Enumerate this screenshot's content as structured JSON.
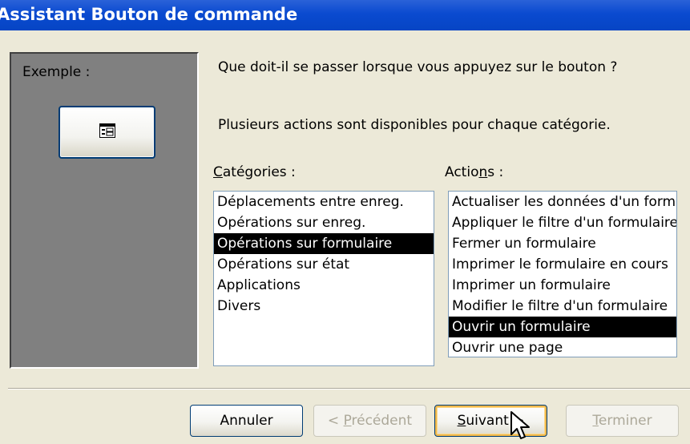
{
  "window": {
    "title": "Assistant Bouton de commande"
  },
  "example": {
    "label": "Exemple :",
    "button_icon": "form-icon"
  },
  "instructions": {
    "question": "Que doit-il se passer lorsque vous appuyez sur le bouton ?",
    "info": "Plusieurs actions sont disponibles pour chaque catégorie."
  },
  "categories": {
    "label_pre": "",
    "label_access": "C",
    "label_post": "atégories :",
    "selected": "Opérations sur formulaire",
    "items": [
      "Déplacements entre enreg.",
      "Opérations sur enreg.",
      "Opérations sur formulaire",
      "Opérations sur état",
      "Applications",
      "Divers"
    ]
  },
  "actions": {
    "label_pre": "Actio",
    "label_access": "n",
    "label_post": "s :",
    "selected": "Ouvrir un formulaire",
    "items": [
      "Actualiser les données d'un formulaire",
      "Appliquer le filtre d'un formulaire",
      "Fermer un formulaire",
      "Imprimer le formulaire en cours",
      "Imprimer un formulaire",
      "Modifier le filtre d'un formulaire",
      "Ouvrir un formulaire",
      "Ouvrir une page"
    ]
  },
  "buttons": {
    "cancel": {
      "label": "Annuler"
    },
    "previous": {
      "pre": "< ",
      "access": "P",
      "post": "récédent"
    },
    "next": {
      "pre": "",
      "access": "S",
      "post": "uivant >"
    },
    "finish": {
      "pre": "",
      "access": "T",
      "post": "erminer"
    }
  },
  "colors": {
    "titlebar": "#0a4ad0",
    "selection": "#000000",
    "panel": "#808080",
    "dialog": "#ece9d8"
  }
}
